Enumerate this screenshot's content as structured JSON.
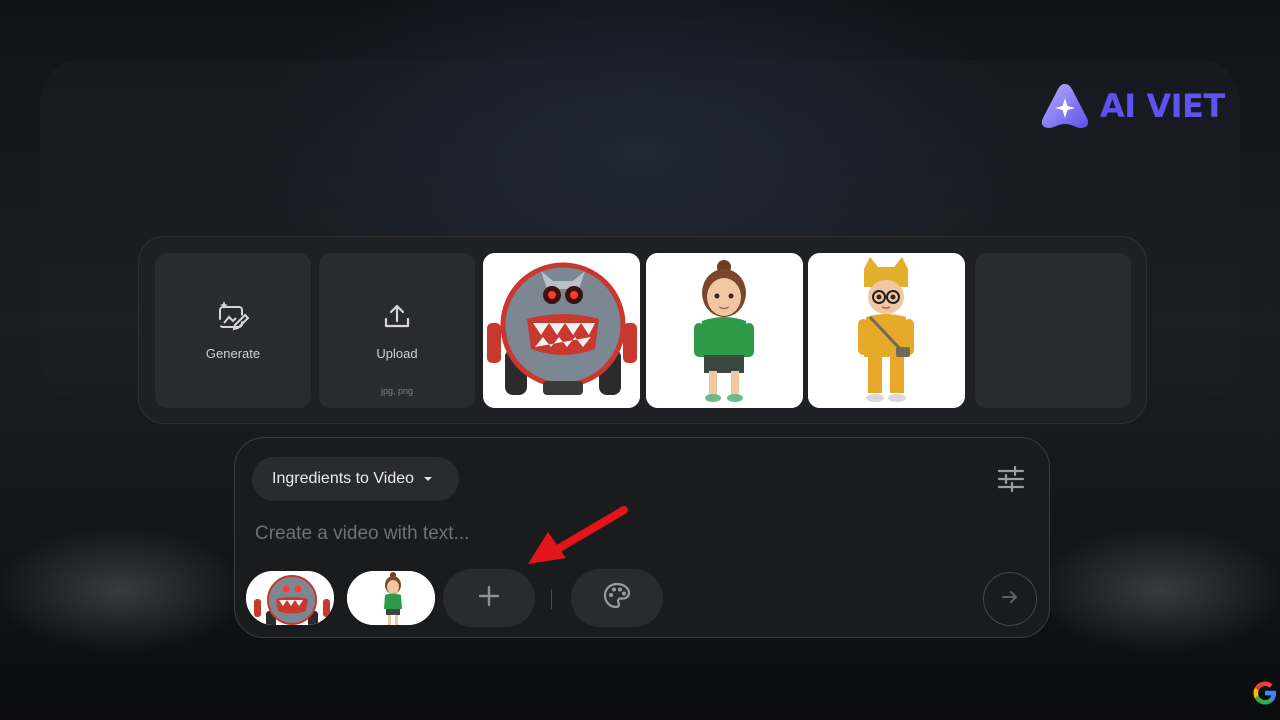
{
  "brand": {
    "name": "AI VIET",
    "color": "#5d54f0"
  },
  "tray": {
    "generate_label": "Generate",
    "upload_label": "Upload",
    "upload_formats": "jpg, png",
    "thumbnails": [
      {
        "name": "robot-character"
      },
      {
        "name": "girl-character-green-hoodie"
      },
      {
        "name": "boy-character-cat-hat-yellow"
      }
    ]
  },
  "prompt": {
    "mode_label": "Ingredients to Video",
    "placeholder": "Create a video with text...",
    "value": "",
    "ingredients": [
      {
        "name": "robot-character"
      },
      {
        "name": "girl-character-green-hoodie"
      }
    ]
  },
  "icons": {
    "generate": "image-sparkle-icon",
    "upload": "upload-icon",
    "settings": "tune-sliders-icon",
    "add": "plus-icon",
    "style": "palette-icon",
    "send": "arrow-right-icon",
    "annotation": "red-arrow-icon",
    "corner": "google-g-icon"
  },
  "colors": {
    "annotation_red": "#e2161a",
    "panel": "#202124",
    "chip": "#2a2b2e"
  }
}
